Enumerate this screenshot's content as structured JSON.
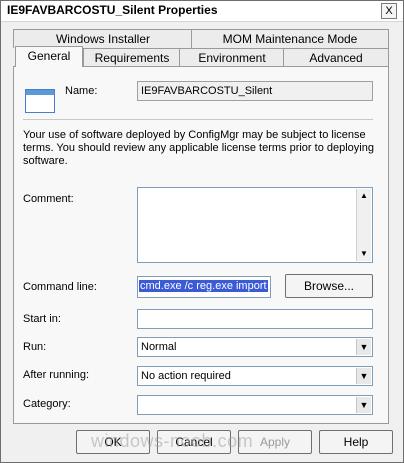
{
  "window": {
    "title": "IE9FAVBARCOSTU_Silent Properties",
    "close_glyph": "X"
  },
  "tabs_row1": [
    {
      "label": "Windows Installer"
    },
    {
      "label": "MOM Maintenance Mode"
    }
  ],
  "tabs_row2": [
    {
      "label": "General",
      "active": true
    },
    {
      "label": "Requirements"
    },
    {
      "label": "Environment"
    },
    {
      "label": "Advanced"
    }
  ],
  "general": {
    "name_label": "Name:",
    "name_value": "IE9FAVBARCOSTU_Silent",
    "notice": "Your use of software deployed by ConfigMgr may be subject to license terms. You should review any applicable license terms prior to deploying software.",
    "comment_label": "Comment:",
    "comment_value": "",
    "command_line_label": "Command line:",
    "command_line_value": "cmd.exe /c reg.exe import",
    "browse_label": "Browse...",
    "start_in_label": "Start in:",
    "start_in_value": "",
    "run_label": "Run:",
    "run_value": "Normal",
    "after_running_label": "After running:",
    "after_running_value": "No action required",
    "category_label": "Category:",
    "category_value": ""
  },
  "buttons": {
    "ok": "OK",
    "cancel": "Cancel",
    "apply": "Apply",
    "help": "Help"
  },
  "watermark": "windows-noob.com"
}
